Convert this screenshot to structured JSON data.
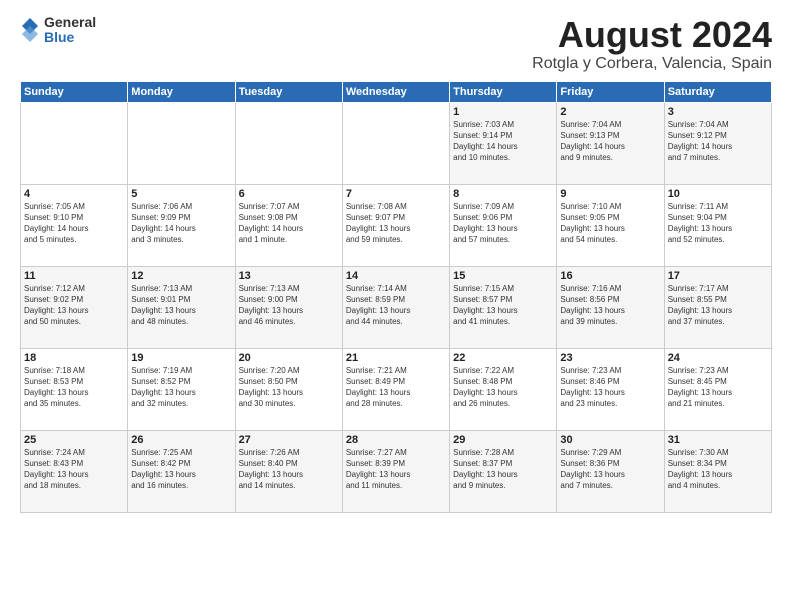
{
  "logo": {
    "general": "General",
    "blue": "Blue"
  },
  "title": "August 2024",
  "subtitle": "Rotgla y Corbera, Valencia, Spain",
  "days_of_week": [
    "Sunday",
    "Monday",
    "Tuesday",
    "Wednesday",
    "Thursday",
    "Friday",
    "Saturday"
  ],
  "weeks": [
    [
      {
        "day": "",
        "info": ""
      },
      {
        "day": "",
        "info": ""
      },
      {
        "day": "",
        "info": ""
      },
      {
        "day": "",
        "info": ""
      },
      {
        "day": "1",
        "info": "Sunrise: 7:03 AM\nSunset: 9:14 PM\nDaylight: 14 hours\nand 10 minutes."
      },
      {
        "day": "2",
        "info": "Sunrise: 7:04 AM\nSunset: 9:13 PM\nDaylight: 14 hours\nand 9 minutes."
      },
      {
        "day": "3",
        "info": "Sunrise: 7:04 AM\nSunset: 9:12 PM\nDaylight: 14 hours\nand 7 minutes."
      }
    ],
    [
      {
        "day": "4",
        "info": "Sunrise: 7:05 AM\nSunset: 9:10 PM\nDaylight: 14 hours\nand 5 minutes."
      },
      {
        "day": "5",
        "info": "Sunrise: 7:06 AM\nSunset: 9:09 PM\nDaylight: 14 hours\nand 3 minutes."
      },
      {
        "day": "6",
        "info": "Sunrise: 7:07 AM\nSunset: 9:08 PM\nDaylight: 14 hours\nand 1 minute."
      },
      {
        "day": "7",
        "info": "Sunrise: 7:08 AM\nSunset: 9:07 PM\nDaylight: 13 hours\nand 59 minutes."
      },
      {
        "day": "8",
        "info": "Sunrise: 7:09 AM\nSunset: 9:06 PM\nDaylight: 13 hours\nand 57 minutes."
      },
      {
        "day": "9",
        "info": "Sunrise: 7:10 AM\nSunset: 9:05 PM\nDaylight: 13 hours\nand 54 minutes."
      },
      {
        "day": "10",
        "info": "Sunrise: 7:11 AM\nSunset: 9:04 PM\nDaylight: 13 hours\nand 52 minutes."
      }
    ],
    [
      {
        "day": "11",
        "info": "Sunrise: 7:12 AM\nSunset: 9:02 PM\nDaylight: 13 hours\nand 50 minutes."
      },
      {
        "day": "12",
        "info": "Sunrise: 7:13 AM\nSunset: 9:01 PM\nDaylight: 13 hours\nand 48 minutes."
      },
      {
        "day": "13",
        "info": "Sunrise: 7:13 AM\nSunset: 9:00 PM\nDaylight: 13 hours\nand 46 minutes."
      },
      {
        "day": "14",
        "info": "Sunrise: 7:14 AM\nSunset: 8:59 PM\nDaylight: 13 hours\nand 44 minutes."
      },
      {
        "day": "15",
        "info": "Sunrise: 7:15 AM\nSunset: 8:57 PM\nDaylight: 13 hours\nand 41 minutes."
      },
      {
        "day": "16",
        "info": "Sunrise: 7:16 AM\nSunset: 8:56 PM\nDaylight: 13 hours\nand 39 minutes."
      },
      {
        "day": "17",
        "info": "Sunrise: 7:17 AM\nSunset: 8:55 PM\nDaylight: 13 hours\nand 37 minutes."
      }
    ],
    [
      {
        "day": "18",
        "info": "Sunrise: 7:18 AM\nSunset: 8:53 PM\nDaylight: 13 hours\nand 35 minutes."
      },
      {
        "day": "19",
        "info": "Sunrise: 7:19 AM\nSunset: 8:52 PM\nDaylight: 13 hours\nand 32 minutes."
      },
      {
        "day": "20",
        "info": "Sunrise: 7:20 AM\nSunset: 8:50 PM\nDaylight: 13 hours\nand 30 minutes."
      },
      {
        "day": "21",
        "info": "Sunrise: 7:21 AM\nSunset: 8:49 PM\nDaylight: 13 hours\nand 28 minutes."
      },
      {
        "day": "22",
        "info": "Sunrise: 7:22 AM\nSunset: 8:48 PM\nDaylight: 13 hours\nand 26 minutes."
      },
      {
        "day": "23",
        "info": "Sunrise: 7:23 AM\nSunset: 8:46 PM\nDaylight: 13 hours\nand 23 minutes."
      },
      {
        "day": "24",
        "info": "Sunrise: 7:23 AM\nSunset: 8:45 PM\nDaylight: 13 hours\nand 21 minutes."
      }
    ],
    [
      {
        "day": "25",
        "info": "Sunrise: 7:24 AM\nSunset: 8:43 PM\nDaylight: 13 hours\nand 18 minutes."
      },
      {
        "day": "26",
        "info": "Sunrise: 7:25 AM\nSunset: 8:42 PM\nDaylight: 13 hours\nand 16 minutes."
      },
      {
        "day": "27",
        "info": "Sunrise: 7:26 AM\nSunset: 8:40 PM\nDaylight: 13 hours\nand 14 minutes."
      },
      {
        "day": "28",
        "info": "Sunrise: 7:27 AM\nSunset: 8:39 PM\nDaylight: 13 hours\nand 11 minutes."
      },
      {
        "day": "29",
        "info": "Sunrise: 7:28 AM\nSunset: 8:37 PM\nDaylight: 13 hours\nand 9 minutes."
      },
      {
        "day": "30",
        "info": "Sunrise: 7:29 AM\nSunset: 8:36 PM\nDaylight: 13 hours\nand 7 minutes."
      },
      {
        "day": "31",
        "info": "Sunrise: 7:30 AM\nSunset: 8:34 PM\nDaylight: 13 hours\nand 4 minutes."
      }
    ]
  ]
}
